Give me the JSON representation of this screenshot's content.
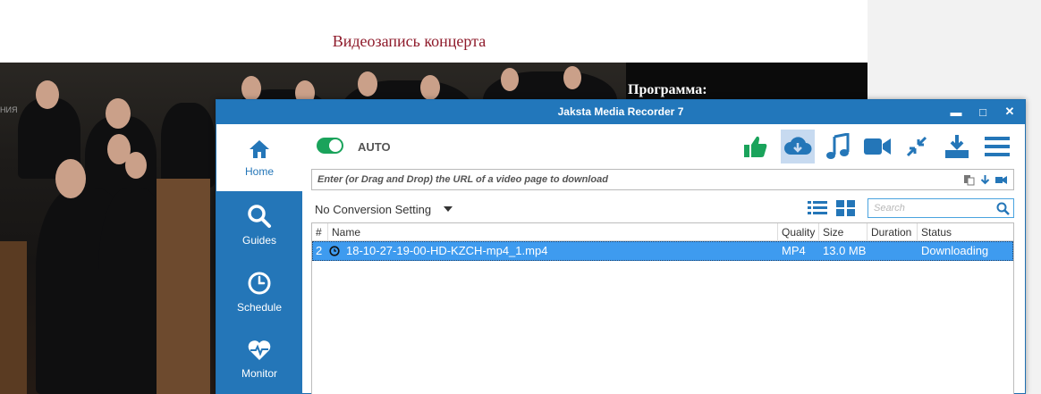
{
  "webpage": {
    "heading": "Видеозапись концерта",
    "program_label": "Программа:"
  },
  "app": {
    "title": "Jaksta Media Recorder 7",
    "window_buttons": {
      "minimize": "▬",
      "maximize": "□",
      "close": "✕"
    },
    "sidebar": [
      {
        "label": "Home",
        "icon": "home-icon",
        "active": true
      },
      {
        "label": "Guides",
        "icon": "search-icon",
        "active": false
      },
      {
        "label": "Schedule",
        "icon": "clock-icon",
        "active": false
      },
      {
        "label": "Monitor",
        "icon": "heart-pulse-icon",
        "active": false
      }
    ],
    "auto": {
      "label": "AUTO",
      "enabled": true
    },
    "toolbar_icons": [
      "thumbs-up-icon",
      "cloud-download-icon",
      "music-note-icon",
      "video-camera-icon",
      "collapse-icon",
      "download-tray-icon",
      "menu-icon"
    ],
    "url_input": {
      "placeholder": "Enter (or Drag and Drop) the URL of a video page to download",
      "value": ""
    },
    "conversion": {
      "selected": "No Conversion Setting"
    },
    "search": {
      "placeholder": "Search",
      "value": ""
    },
    "table": {
      "columns": [
        "#",
        "Name",
        "Quality",
        "Size",
        "Duration",
        "Status"
      ],
      "rows": [
        {
          "num": "2",
          "name": "18-10-27-19-00-HD-KZCH-mp4_1.mp4",
          "quality": "MP4",
          "size": "13.0 MB",
          "duration": "",
          "status": "Downloading"
        }
      ]
    },
    "colors": {
      "titlebar": "#2277bb",
      "sidebar": "#2476b8",
      "toggle_on": "#1aa35b",
      "selected_row": "#3e9bef",
      "heading": "#8e1a2a"
    }
  }
}
